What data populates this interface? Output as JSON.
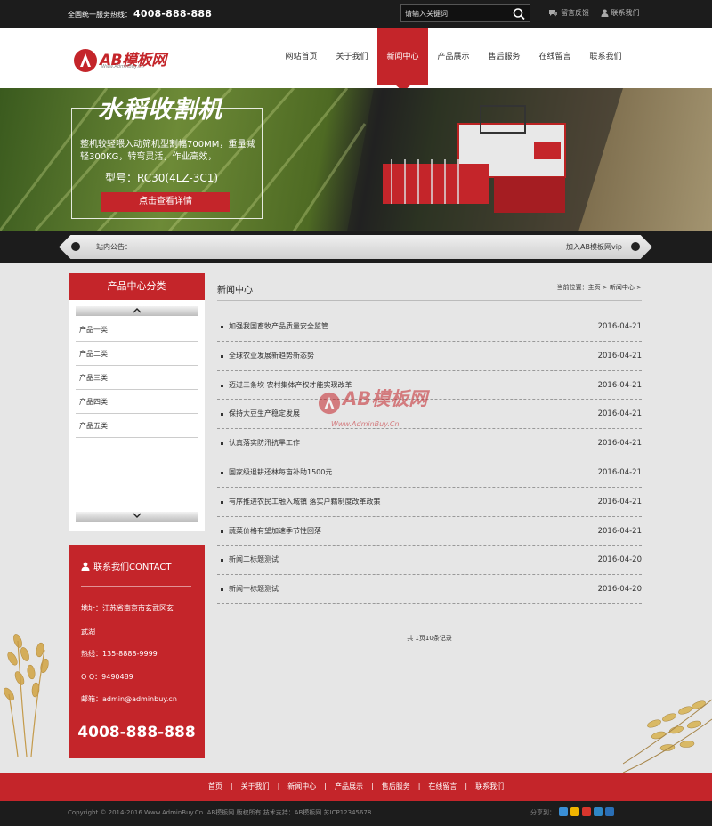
{
  "topbar": {
    "hotline_label": "全国统一服务热线：",
    "hotline_number": "4008-888-888",
    "search_placeholder": "请输入关键词",
    "feedback_label": "留言反馈",
    "contact_label": "联系我们"
  },
  "header": {
    "logo_text": "AB模板网",
    "logo_sub": "Www.AdminBuy.Cn",
    "nav": [
      {
        "label": "网站首页",
        "active": false
      },
      {
        "label": "关于我们",
        "active": false
      },
      {
        "label": "新闻中心",
        "active": true
      },
      {
        "label": "产品展示",
        "active": false
      },
      {
        "label": "售后服务",
        "active": false
      },
      {
        "label": "在线留言",
        "active": false
      },
      {
        "label": "联系我们",
        "active": false
      }
    ]
  },
  "banner": {
    "title": "水稻收割机",
    "text": "整机较轻喂入动筛机型割幅700MM，重量减轻300KG，转弯灵活，作业高效，",
    "model": "型号：RC30(4LZ-3C1)",
    "button": "点击查看详情"
  },
  "notice": {
    "label": "站内公告：",
    "right": "加入AB模板网vip"
  },
  "sidebar": {
    "category_title": "产品中心分类",
    "categories": [
      "产品一类",
      "产品二类",
      "产品三类",
      "产品四类",
      "产品五类"
    ],
    "contact_title": "联系我们CONTACT",
    "address_line1": "地址：江苏省南京市玄武区玄",
    "address_line2": "武湖",
    "hotline": "热线：135-8888-9999",
    "qq": "Q Q：9490489",
    "email": "邮箱：admin@adminbuy.cn",
    "big_phone": "4008-888-888"
  },
  "main": {
    "title": "新闻中心",
    "breadcrumb": "当前位置：主页 > 新闻中心 >",
    "news": [
      {
        "title": "加强我国畜牧产品质量安全监管",
        "date": "2016-04-21"
      },
      {
        "title": "全球农业发展新趋势新态势",
        "date": "2016-04-21"
      },
      {
        "title": "迈过三条坎 农村集体产权才能实现改革",
        "date": "2016-04-21"
      },
      {
        "title": "保持大豆生产稳定发展",
        "date": "2016-04-21"
      },
      {
        "title": "认真落实防汛抗旱工作",
        "date": "2016-04-21"
      },
      {
        "title": "国家级退耕还林每亩补助1500元",
        "date": "2016-04-21"
      },
      {
        "title": "有序推进农民工融入城镇 落实户籍制度改革政策",
        "date": "2016-04-21"
      },
      {
        "title": "蔬菜价格有望加速季节性回落",
        "date": "2016-04-21"
      },
      {
        "title": "新闻二标题测试",
        "date": "2016-04-20"
      },
      {
        "title": "新闻一标题测试",
        "date": "2016-04-20"
      }
    ],
    "pager": "共 1页10条记录"
  },
  "watermark": {
    "text": "AB模板网",
    "sub": "Www.AdminBuy.Cn"
  },
  "footer": {
    "nav": [
      "首页",
      "关于我们",
      "新闻中心",
      "产品展示",
      "售后服务",
      "在线留言",
      "联系我们"
    ],
    "copyright": "Copyright © 2014-2016 Www.AdminBuy.Cn. AB模板网 版权所有    技术支持：AB模板网    苏ICP12345678",
    "share_label": "分享到："
  },
  "colors": {
    "brand_red": "#c4252a",
    "dark_bar": "#1c1c1c",
    "page_bg": "#e6e6e6"
  }
}
